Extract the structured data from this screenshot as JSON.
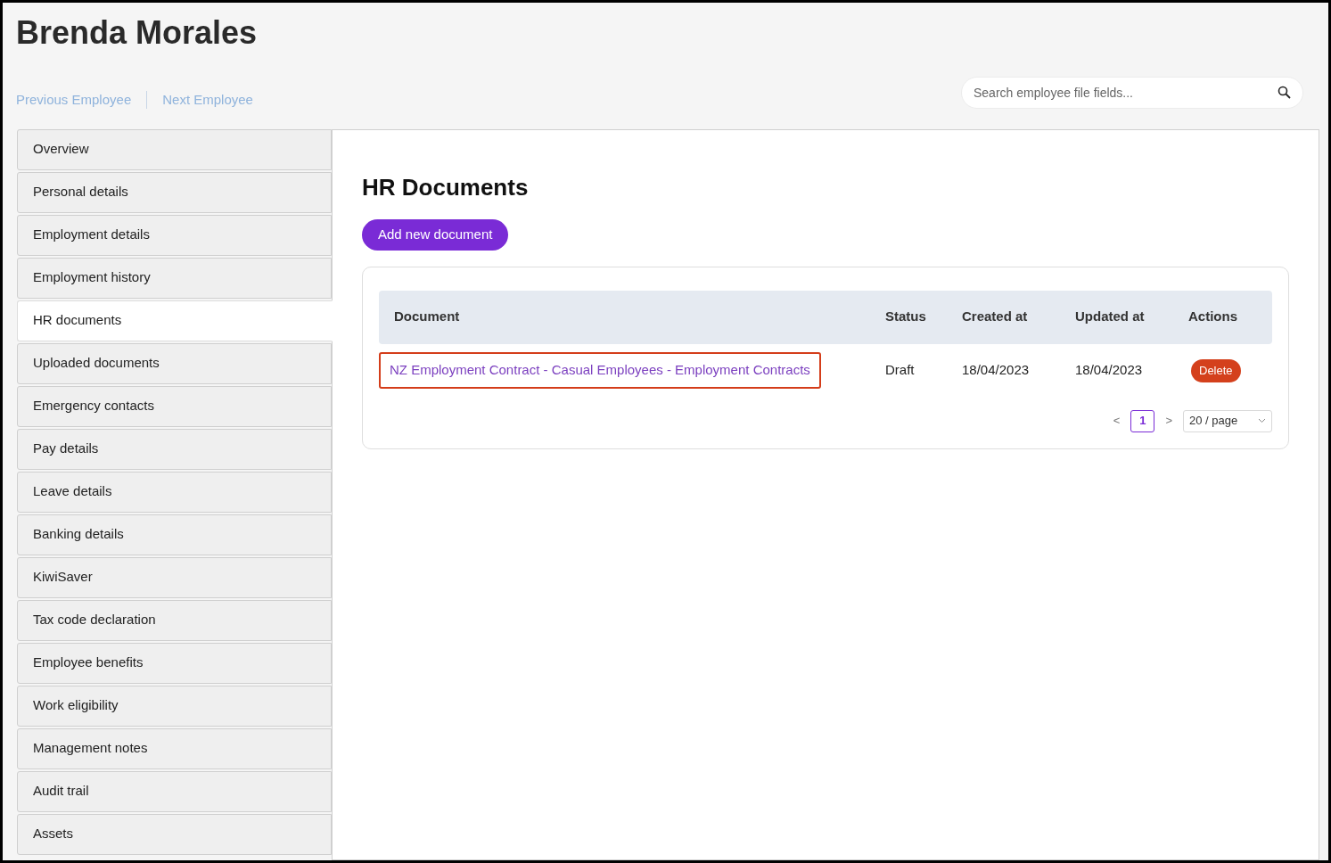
{
  "employee_name": "Brenda Morales",
  "nav_links": [
    "Previous Employee",
    "Next Employee"
  ],
  "search": {
    "placeholder": "Search employee file fields..."
  },
  "sidebar": {
    "items": [
      {
        "label": "Overview",
        "selected": false
      },
      {
        "label": "Personal details",
        "selected": false
      },
      {
        "label": "Employment details",
        "selected": false
      },
      {
        "label": "Employment history",
        "selected": false
      },
      {
        "label": "HR documents",
        "selected": true
      },
      {
        "label": "Uploaded documents",
        "selected": false
      },
      {
        "label": "Emergency contacts",
        "selected": false
      },
      {
        "label": "Pay details",
        "selected": false
      },
      {
        "label": "Leave details",
        "selected": false
      },
      {
        "label": "Banking details",
        "selected": false
      },
      {
        "label": "KiwiSaver",
        "selected": false
      },
      {
        "label": "Tax code declaration",
        "selected": false
      },
      {
        "label": "Employee benefits",
        "selected": false
      },
      {
        "label": "Work eligibility",
        "selected": false
      },
      {
        "label": "Management notes",
        "selected": false
      },
      {
        "label": "Audit trail",
        "selected": false
      },
      {
        "label": "Assets",
        "selected": false
      }
    ]
  },
  "main": {
    "title": "HR Documents",
    "add_button": "Add new document",
    "table": {
      "columns": [
        "Document",
        "Status",
        "Created at",
        "Updated at",
        "Actions"
      ],
      "rows": [
        {
          "document": "NZ Employment Contract - Casual Employees - Employment Contracts",
          "highlighted": true,
          "status": "Draft",
          "created_at": "18/04/2023",
          "updated_at": "18/04/2023",
          "action": "Delete"
        }
      ]
    },
    "pagination": {
      "prev": "<",
      "pages": [
        {
          "label": "1",
          "selected": true
        }
      ],
      "next": ">",
      "page_size": "20 / page"
    }
  }
}
